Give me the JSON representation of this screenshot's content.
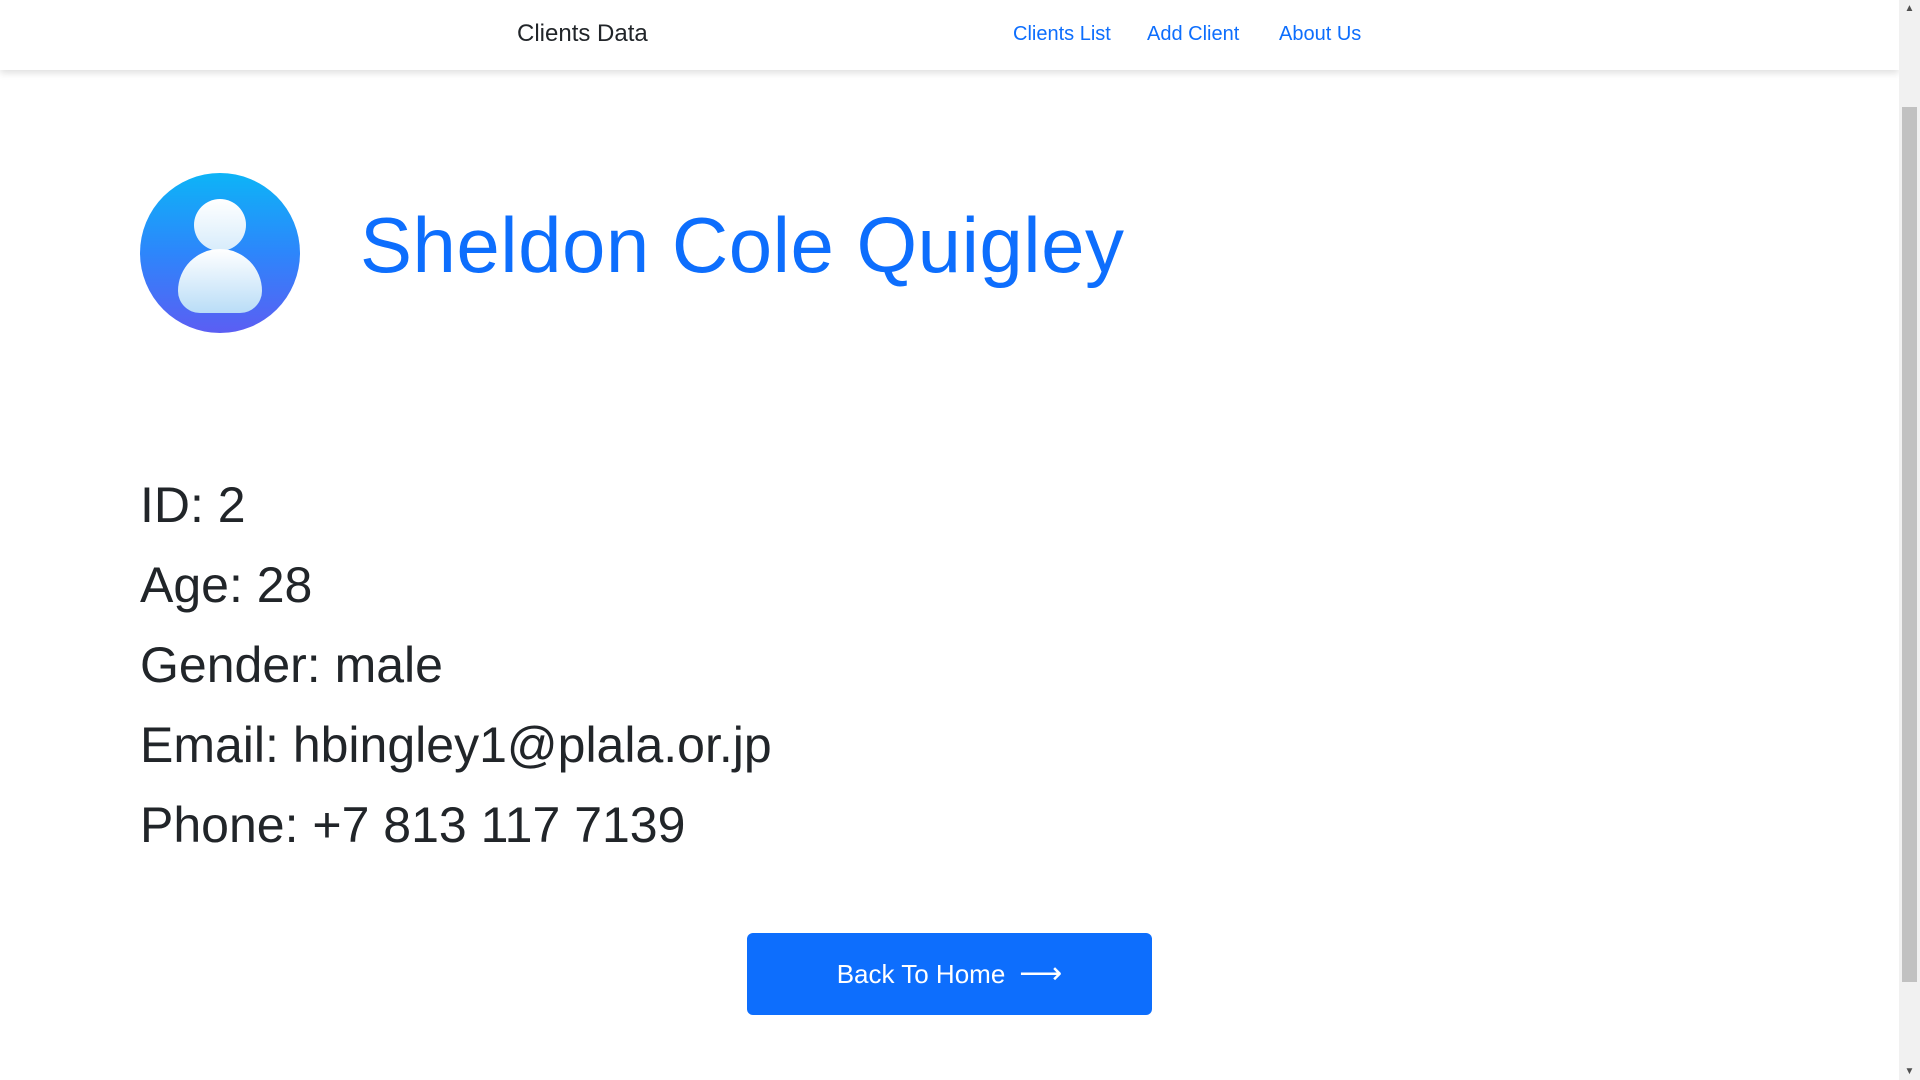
{
  "navbar": {
    "brand": "Clients Data",
    "links": [
      "Clients List",
      "Add Client",
      "About Us"
    ]
  },
  "client": {
    "name": "Sheldon Cole Quigley",
    "details": [
      {
        "label": "ID: ",
        "value": "2"
      },
      {
        "label": "Age: ",
        "value": "28"
      },
      {
        "label": "Gender: ",
        "value": "male"
      },
      {
        "label": "Email: ",
        "value": "hbingley1@plala.or.jp"
      },
      {
        "label": "Phone: ",
        "value": "+7 813 117 7139"
      }
    ]
  },
  "back_button": {
    "label": "Back To Home",
    "icon": "arrow-right-icon"
  },
  "colors": {
    "primary": "#0d6efd",
    "text": "#212529"
  }
}
